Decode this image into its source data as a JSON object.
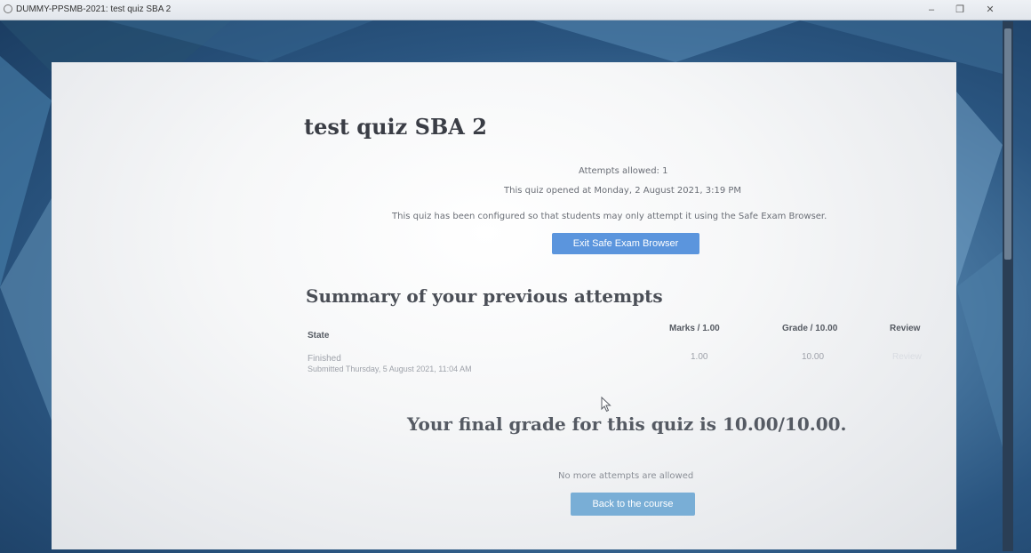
{
  "window": {
    "title": "DUMMY-PPSMB-2021: test quiz SBA 2",
    "controls": {
      "minimize": "–",
      "maximize": "❐",
      "close": "✕"
    }
  },
  "quiz": {
    "title": "test quiz SBA 2",
    "attempts_allowed": "Attempts allowed: 1",
    "opened_at": "This quiz opened at Monday, 2 August 2021, 3:19 PM",
    "seb_notice": "This quiz has been configured so that students may only attempt it using the Safe Exam Browser.",
    "exit_seb_button": "Exit Safe Exam Browser"
  },
  "summary": {
    "title": "Summary of your previous attempts",
    "headers": {
      "state": "State",
      "marks": "Marks / 1.00",
      "grade": "Grade / 10.00",
      "review": "Review"
    },
    "rows": [
      {
        "state": "Finished",
        "submitted": "Submitted Thursday, 5 August 2021, 11:04 AM",
        "marks": "1.00",
        "grade": "10.00",
        "review": "Review"
      }
    ]
  },
  "final_grade": "Your final grade for this quiz is 10.00/10.00.",
  "no_more_attempts": "No more attempts are allowed",
  "back_button": "Back to the course",
  "colors": {
    "primary_button": "#5b95dd",
    "secondary_button": "#79aed6",
    "panel": "#f6f7f8",
    "heading": "#3a3d45"
  },
  "icons": [
    "app-icon",
    "cursor-icon"
  ]
}
